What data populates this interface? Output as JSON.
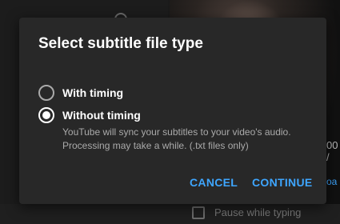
{
  "dialog": {
    "title": "Select subtitle file type",
    "options": [
      {
        "label": "With timing",
        "checked": false
      },
      {
        "label": "Without timing",
        "checked": true
      }
    ],
    "description": "YouTube will sync your subtitles to your video's audio. Processing may take a while. (.txt files only)",
    "cancel_label": "CANCEL",
    "continue_label": "CONTINUE"
  },
  "background": {
    "edge_text_1": "00 /",
    "edge_text_2": "oa",
    "checkbox_label": "Pause while typing"
  },
  "colors": {
    "accent": "#3ea6ff",
    "dialog_bg": "#282828",
    "text_primary": "#ffffff",
    "text_secondary": "#aaaaaa"
  }
}
